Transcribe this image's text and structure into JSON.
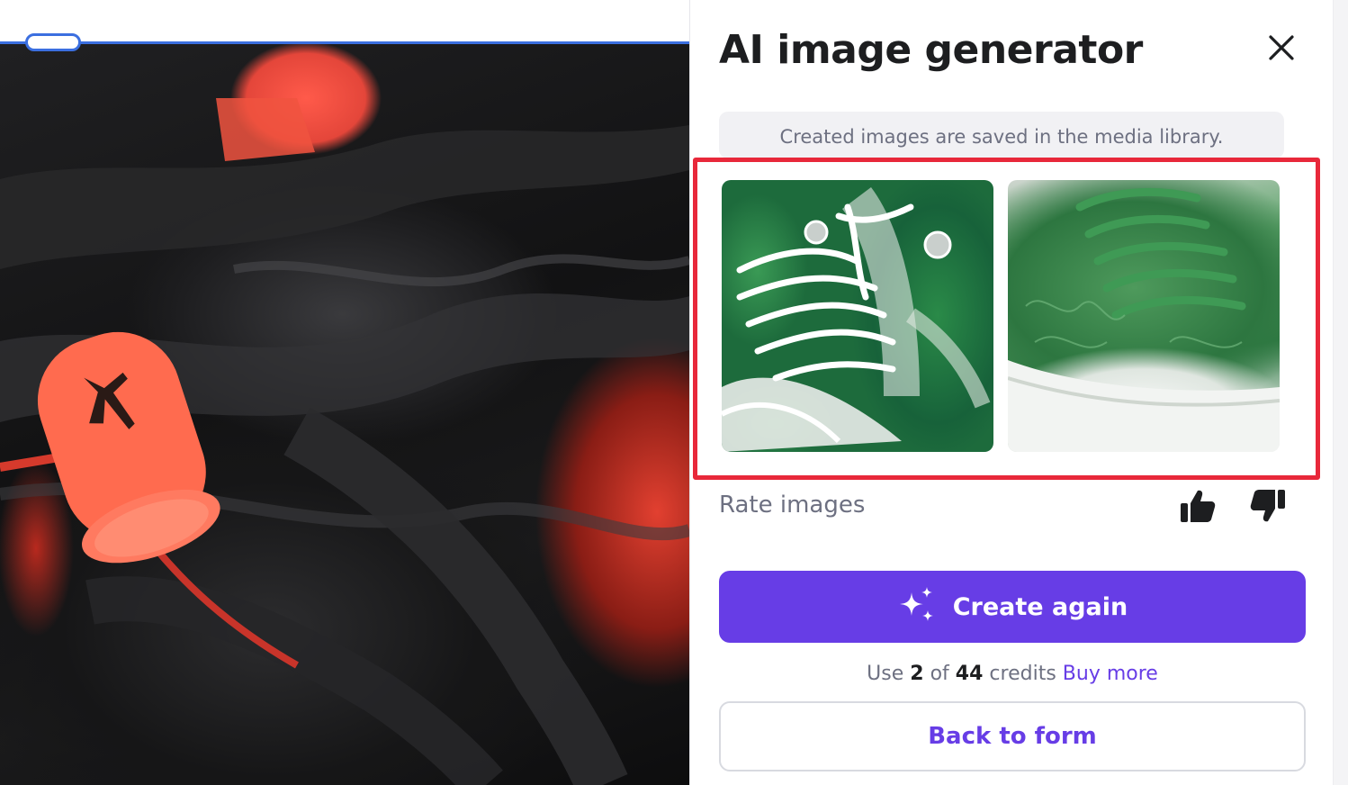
{
  "canvas": {
    "background_photo": "close-up of black sneaker with orange lace toggle",
    "selection_color": "#3b6fe0"
  },
  "panel": {
    "title": "AI image generator",
    "close_icon": "close-icon",
    "info_note": "Created images are saved in the media library.",
    "highlight_color": "#e8283a",
    "images": [
      {
        "name": "generated-image-1",
        "subject": "green and white patterned high-top sneaker"
      },
      {
        "name": "generated-image-2",
        "subject": "green embossed low-top sneaker"
      }
    ],
    "rate_label": "Rate images",
    "rate_icons": [
      "thumbs-up-icon",
      "thumbs-down-icon"
    ],
    "create_button": {
      "label": "Create again",
      "icon": "sparkles-icon",
      "color": "#673de6"
    },
    "credits": {
      "use": "Use",
      "amount": "2",
      "of": "of",
      "total": "44",
      "unit": "credits",
      "buy_more": "Buy more"
    },
    "back_button": {
      "label": "Back to form"
    }
  }
}
